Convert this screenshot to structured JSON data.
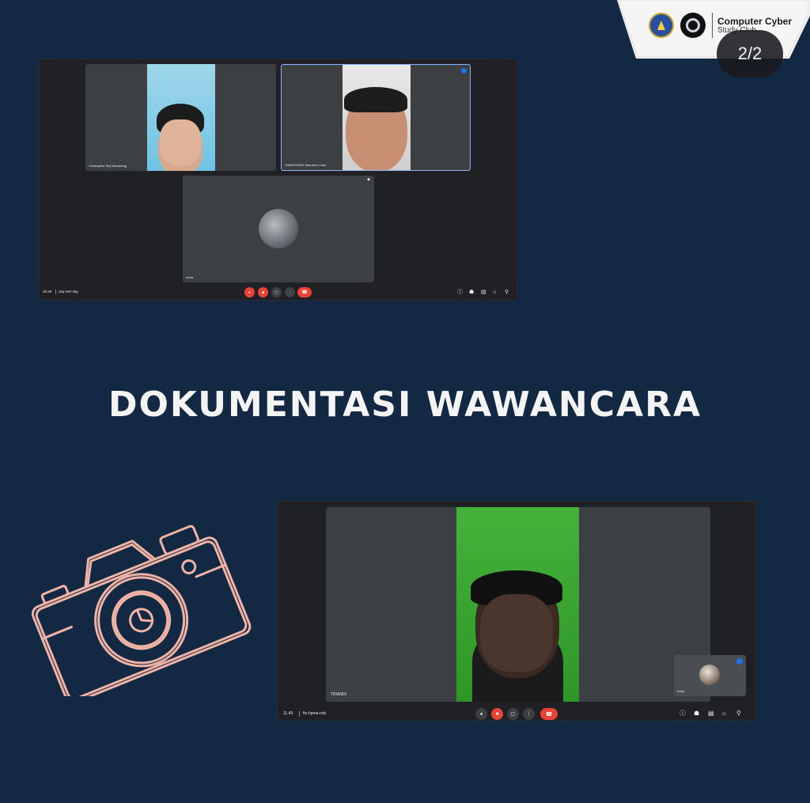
{
  "brand": {
    "title": "Computer Cyber",
    "subtitle": "Study Club",
    "counter": "2/2"
  },
  "heading": "DOKUMENTASI WAWANCARA",
  "meet1": {
    "participants": [
      {
        "name": "Christopher Rey Manarang"
      },
      {
        "name": "19609202001 Marulam Lubis"
      },
      {
        "name": "Anda"
      }
    ],
    "time": "20.36",
    "code": "ukq-vvtr-vbg"
  },
  "meet2": {
    "participants": [
      {
        "name": "TRIANDI"
      },
      {
        "name": "Anda"
      }
    ],
    "time": "11.49",
    "code": "ftx-hpma-nzb"
  },
  "colors": {
    "background": "#132842",
    "meet_bg": "#202124",
    "tile_bg": "#3c4043",
    "end_call": "#ea4335",
    "camera_sketch": "#f0b3a5"
  },
  "icons": [
    "mic-off-icon",
    "cam-off-icon",
    "present-icon",
    "more-icon",
    "end-call-icon",
    "info-icon",
    "people-icon",
    "chat-icon",
    "activities-icon",
    "lock-icon",
    "camera-sketch-icon"
  ]
}
